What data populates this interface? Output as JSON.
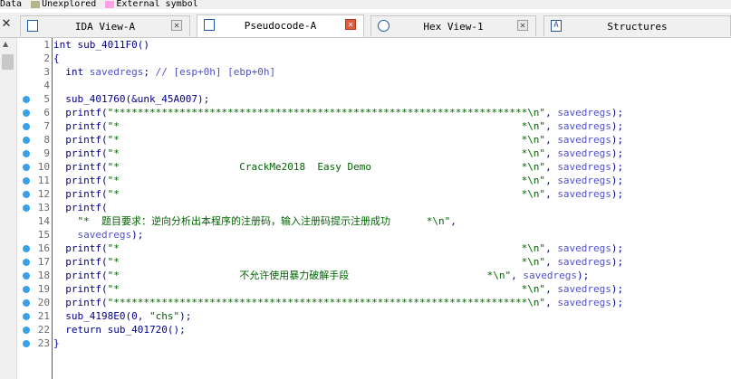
{
  "legend": {
    "items": [
      {
        "label": "Data",
        "color": ""
      },
      {
        "label": "Unexplored",
        "color": "#b5b58a"
      },
      {
        "label": "External symbol",
        "color": "#ffa0e8"
      }
    ]
  },
  "tabs": [
    {
      "label": "IDA View-A",
      "icon": "ida-view-icon",
      "active": false
    },
    {
      "label": "Pseudocode-A",
      "icon": "pseudocode-icon",
      "active": true
    },
    {
      "label": "Hex View-1",
      "icon": "hex-view-icon",
      "active": false
    },
    {
      "label": "Structures",
      "icon": "structures-icon",
      "active": false
    }
  ],
  "left_close": "✕",
  "colors": {
    "keyword": "#00008b",
    "string": "#006400",
    "variable": "#5050c8",
    "breakpoint": "#3aa0e8"
  },
  "code": {
    "lines": [
      {
        "num": "1",
        "bp": false,
        "text": "int sub_4011F0()"
      },
      {
        "num": "2",
        "bp": false,
        "text": "{"
      },
      {
        "num": "3",
        "bp": false,
        "text": "  int savedregs; // [esp+0h] [ebp+0h]"
      },
      {
        "num": "4",
        "bp": false,
        "text": ""
      },
      {
        "num": "5",
        "bp": true,
        "text": "  sub_401760(&unk_45A007);"
      },
      {
        "num": "6",
        "bp": true,
        "text": "  printf(\"*********************************************************************\\n\", savedregs);"
      },
      {
        "num": "7",
        "bp": true,
        "text": "  printf(\"*                                                                   *\\n\", savedregs);"
      },
      {
        "num": "8",
        "bp": true,
        "text": "  printf(\"*                                                                   *\\n\", savedregs);"
      },
      {
        "num": "9",
        "bp": true,
        "text": "  printf(\"*                                                                   *\\n\", savedregs);"
      },
      {
        "num": "10",
        "bp": true,
        "text": "  printf(\"*                    CrackMe2018  Easy Demo                         *\\n\", savedregs);"
      },
      {
        "num": "11",
        "bp": true,
        "text": "  printf(\"*                                                                   *\\n\", savedregs);"
      },
      {
        "num": "12",
        "bp": true,
        "text": "  printf(\"*                                                                   *\\n\", savedregs);"
      },
      {
        "num": "13",
        "bp": true,
        "text": "  printf("
      },
      {
        "num": "14",
        "bp": false,
        "text": "    \"*  题目要求：逆向分析出本程序的注册码，输入注册码提示注册成功      *\\n\","
      },
      {
        "num": "15",
        "bp": false,
        "text": "    savedregs);"
      },
      {
        "num": "16",
        "bp": true,
        "text": "  printf(\"*                                                                   *\\n\", savedregs);"
      },
      {
        "num": "17",
        "bp": true,
        "text": "  printf(\"*                                                                   *\\n\", savedregs);"
      },
      {
        "num": "18",
        "bp": true,
        "text": "  printf(\"*                    不允许使用暴力破解手段                       *\\n\", savedregs);"
      },
      {
        "num": "19",
        "bp": true,
        "text": "  printf(\"*                                                                   *\\n\", savedregs);"
      },
      {
        "num": "20",
        "bp": true,
        "text": "  printf(\"*********************************************************************\\n\", savedregs);"
      },
      {
        "num": "21",
        "bp": true,
        "text": "  sub_4198E0(0, \"chs\");"
      },
      {
        "num": "22",
        "bp": true,
        "text": "  return sub_401720();"
      },
      {
        "num": "23",
        "bp": true,
        "text": "}"
      }
    ]
  }
}
